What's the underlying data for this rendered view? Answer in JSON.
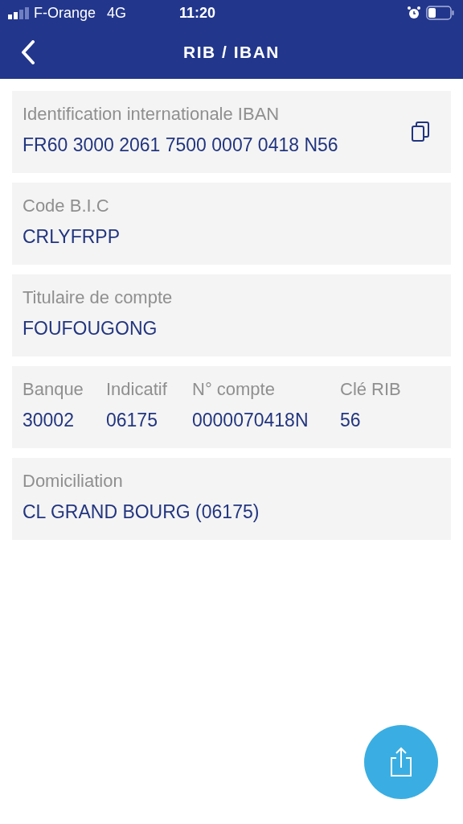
{
  "status_bar": {
    "carrier": "F-Orange",
    "network": "4G",
    "time": "11:20"
  },
  "header": {
    "title": "RIB / IBAN"
  },
  "cards": [
    {
      "kind": "field",
      "label": "Identification internationale IBAN",
      "value": "FR60 3000 2061 7500 0007 0418 N56",
      "copyable": true
    },
    {
      "kind": "field",
      "label": "Code B.I.C",
      "value": "CRLYFRPP",
      "copyable": false
    },
    {
      "kind": "field",
      "label": "Titulaire de compte",
      "value": "FOUFOUGONG",
      "copyable": false
    },
    {
      "kind": "columns",
      "columns": [
        {
          "label": "Banque",
          "value": "30002"
        },
        {
          "label": "Indicatif",
          "value": "06175"
        },
        {
          "label": "N° compte",
          "value": "0000070418N"
        },
        {
          "label": "Clé RIB",
          "value": "56"
        }
      ]
    },
    {
      "kind": "field",
      "label": "Domiciliation",
      "value": "CL GRAND BOURG (06175)",
      "copyable": false
    }
  ]
}
